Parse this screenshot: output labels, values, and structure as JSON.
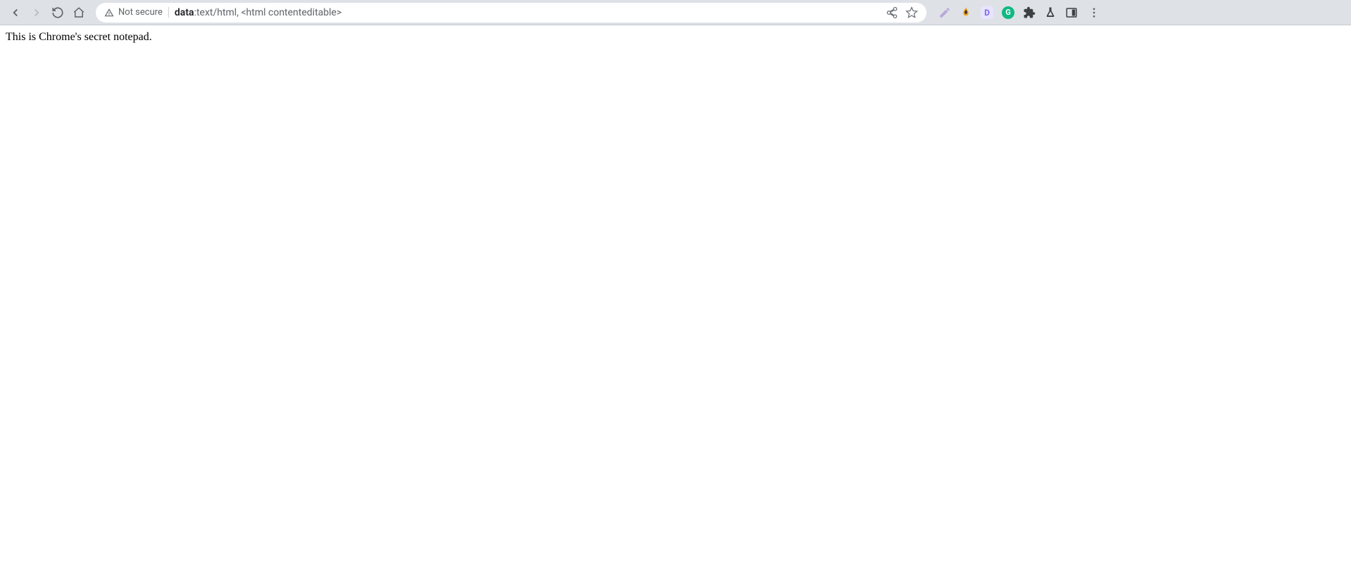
{
  "toolbar": {
    "security_label": "Not secure",
    "url_scheme": "data",
    "url_rest": ":text/html, <html contenteditable>"
  },
  "extensions": {
    "d_label": "D",
    "g_label": "G"
  },
  "content": {
    "text": "This is Chrome's secret notepad."
  }
}
